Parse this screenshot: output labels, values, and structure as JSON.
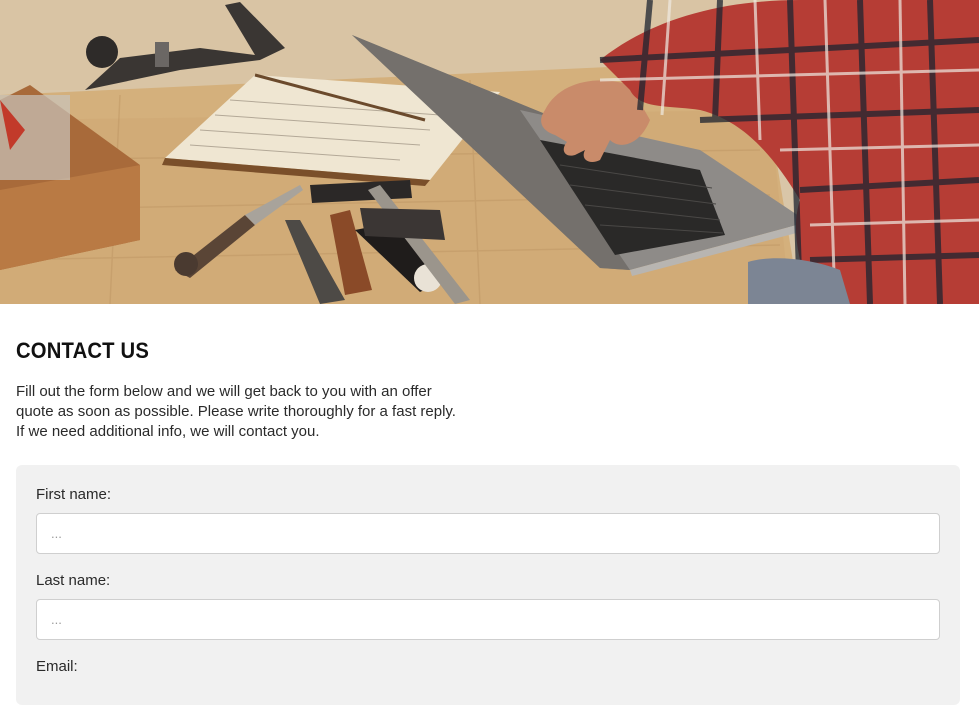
{
  "hero": {
    "image_description_icon": "workshop-laptop-image"
  },
  "contact": {
    "title": "CONTACT US",
    "intro": "Fill out the form below and we will get back to you with an offer quote as soon as possible. Please write thoroughly for a fast reply. If we need additional info, we will contact you."
  },
  "form": {
    "first_name_label": "First name:",
    "first_name_placeholder": "...",
    "last_name_label": "Last name:",
    "last_name_placeholder": "...",
    "email_label": "Email:"
  },
  "colors": {
    "form_background": "#f1f1f1",
    "input_border": "#cfcfcf",
    "text": "#1f1f1f"
  }
}
